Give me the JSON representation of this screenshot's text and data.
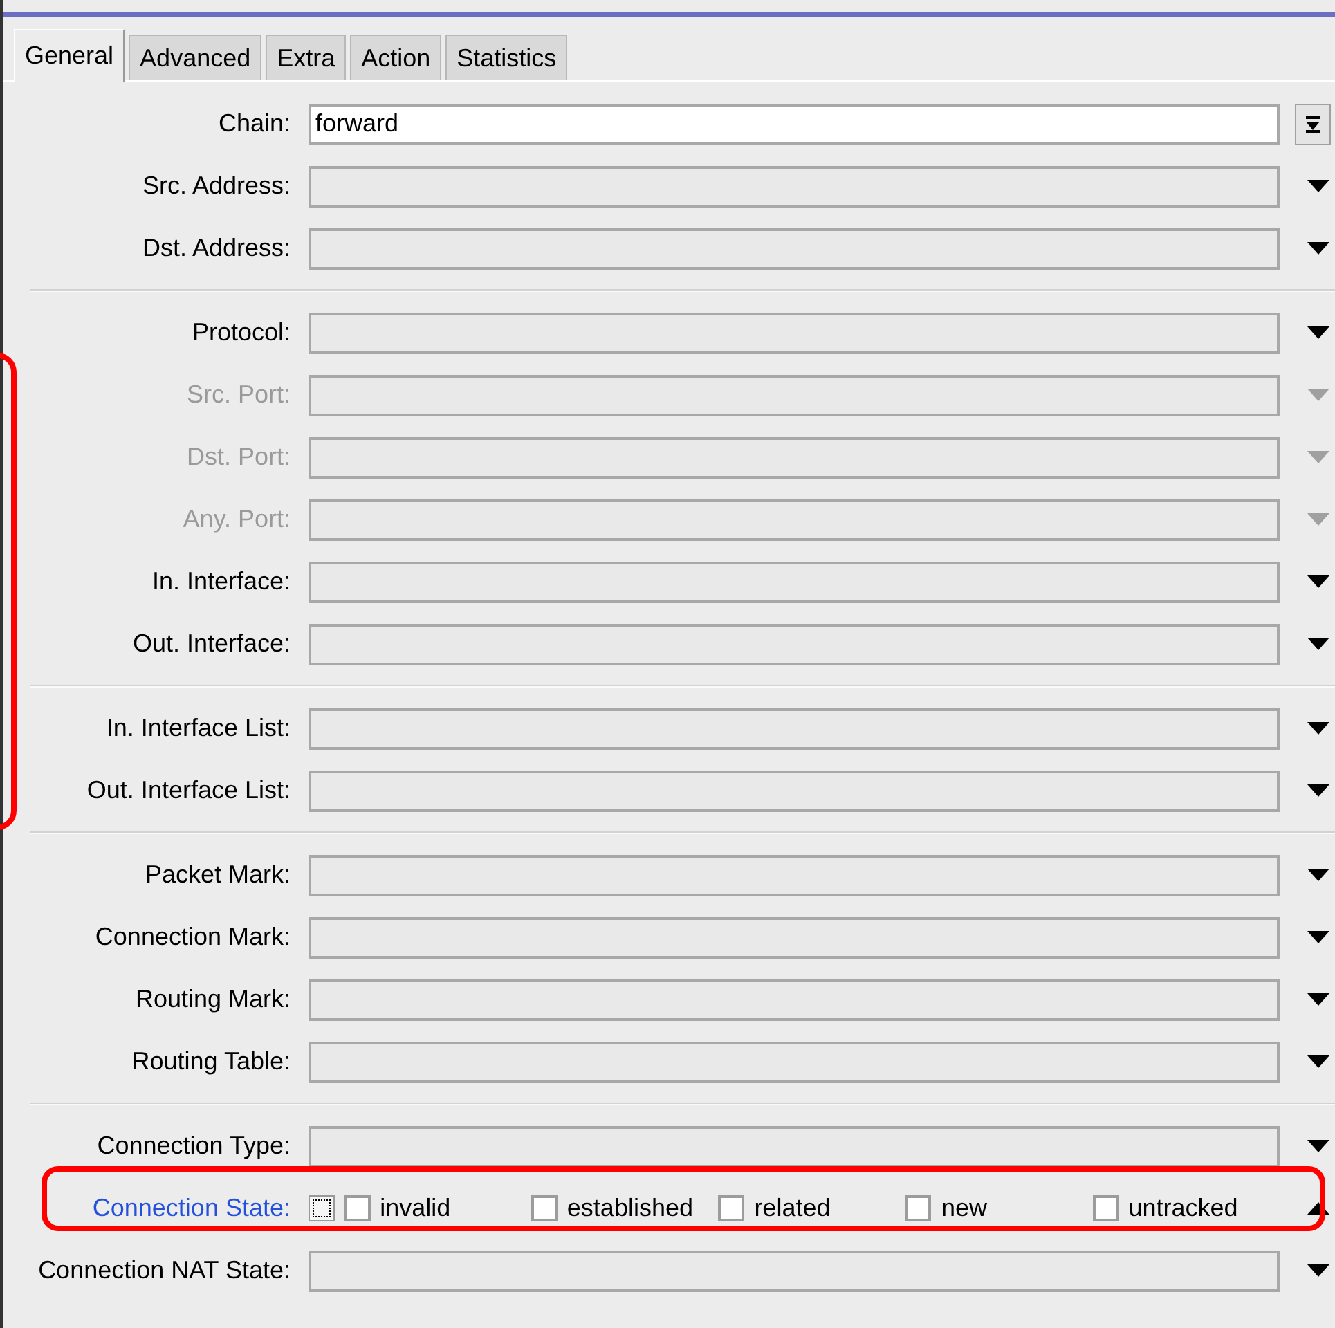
{
  "tabs": [
    {
      "label": "General",
      "selected": true
    },
    {
      "label": "Advanced",
      "selected": false
    },
    {
      "label": "Extra",
      "selected": false
    },
    {
      "label": "Action",
      "selected": false
    },
    {
      "label": "Statistics",
      "selected": false
    }
  ],
  "groups": [
    {
      "fields": [
        {
          "kind": "text",
          "label": "Chain:",
          "value": "forward",
          "disabled": false
        },
        {
          "kind": "combo",
          "label": "Src. Address:",
          "disabled": false
        },
        {
          "kind": "combo",
          "label": "Dst. Address:",
          "disabled": false
        }
      ]
    },
    {
      "fields": [
        {
          "kind": "combo",
          "label": "Protocol:",
          "disabled": false
        },
        {
          "kind": "combo",
          "label": "Src. Port:",
          "disabled": true
        },
        {
          "kind": "combo",
          "label": "Dst. Port:",
          "disabled": true
        },
        {
          "kind": "combo",
          "label": "Any. Port:",
          "disabled": true
        },
        {
          "kind": "combo",
          "label": "In. Interface:",
          "disabled": false
        },
        {
          "kind": "combo",
          "label": "Out. Interface:",
          "disabled": false
        }
      ]
    },
    {
      "fields": [
        {
          "kind": "combo",
          "label": "In. Interface List:",
          "disabled": false
        },
        {
          "kind": "combo",
          "label": "Out. Interface List:",
          "disabled": false
        }
      ]
    },
    {
      "fields": [
        {
          "kind": "combo",
          "label": "Packet Mark:",
          "disabled": false
        },
        {
          "kind": "combo",
          "label": "Connection Mark:",
          "disabled": false
        },
        {
          "kind": "combo",
          "label": "Routing Mark:",
          "disabled": false
        },
        {
          "kind": "combo",
          "label": "Routing Table:",
          "disabled": false
        }
      ]
    },
    {
      "fields": [
        {
          "kind": "combo",
          "label": "Connection Type:",
          "disabled": false
        },
        {
          "kind": "checks",
          "label": "Connection State:",
          "disabled": false,
          "highlighted": true,
          "options": [
            {
              "label": "invalid",
              "checked": false
            },
            {
              "label": "established",
              "checked": false
            },
            {
              "label": "related",
              "checked": false
            },
            {
              "label": "new",
              "checked": false
            },
            {
              "label": "untracked",
              "checked": false
            }
          ]
        },
        {
          "kind": "combo",
          "label": "Connection NAT State:",
          "disabled": false
        }
      ]
    }
  ]
}
